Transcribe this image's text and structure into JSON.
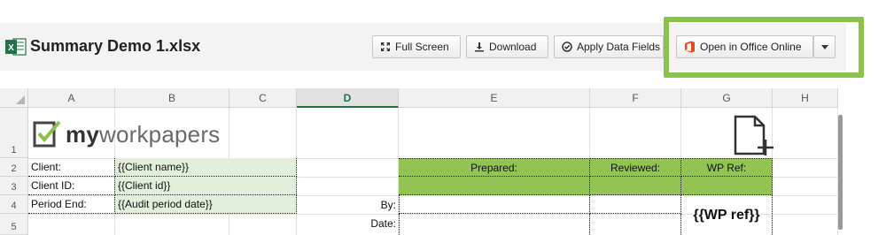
{
  "file": {
    "title": "Summary Demo 1.xlsx",
    "app_icon": "excel-icon"
  },
  "toolbar": {
    "full_screen": "Full Screen",
    "download": "Download",
    "apply_data_fields": "Apply Data Fields",
    "open_office_online": "Open in Office Online"
  },
  "colors": {
    "highlight": "#8bc34a",
    "header_green": "#92c353",
    "field_green": "#e2efda",
    "excel_green": "#217346",
    "office_orange": "#e64a19"
  },
  "sheet": {
    "columns": [
      "A",
      "B",
      "C",
      "D",
      "E",
      "F",
      "G",
      "H"
    ],
    "active_column": "D",
    "rows": [
      "1",
      "2",
      "3",
      "4",
      "5"
    ],
    "logo": {
      "prefix": "my",
      "suffix": "workpapers"
    },
    "add_file_icon": "add-document-icon",
    "labels": {
      "client": "Client:",
      "client_id": "Client ID:",
      "period_end": "Period End:",
      "by": "By:",
      "date": "Date:"
    },
    "fields": {
      "client_name": "{{Client name}}",
      "client_id": "{{Client id}}",
      "audit_period": "{{Audit period date}}"
    },
    "headers": {
      "prepared": "Prepared:",
      "reviewed": "Reviewed:",
      "wp_ref": "WP Ref:"
    },
    "wp_ref_value": "{{WP ref}}"
  }
}
